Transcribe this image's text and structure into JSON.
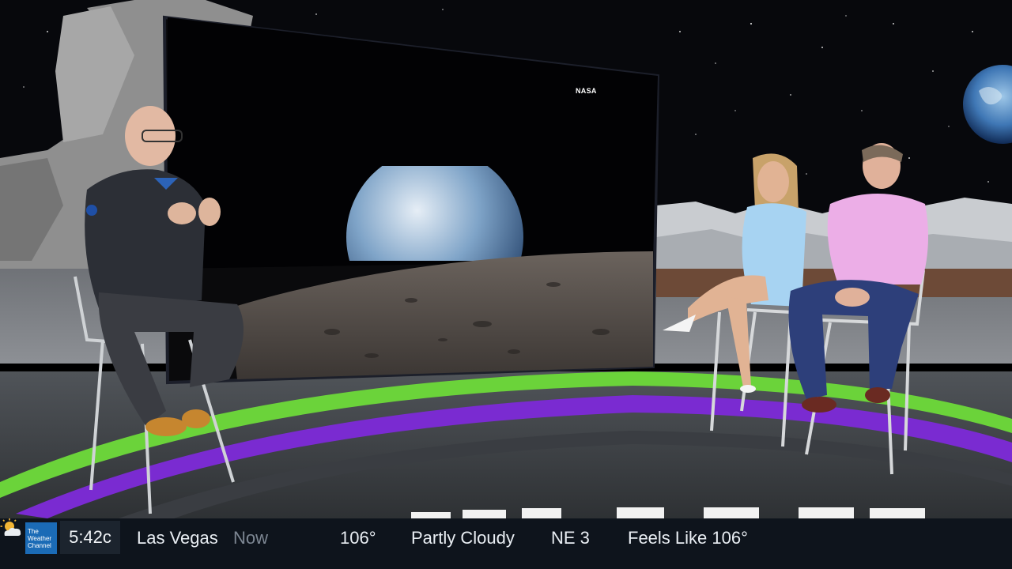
{
  "screen": {
    "watermark": "NASA"
  },
  "ticker": {
    "logo_line1": "The",
    "logo_line2": "Weather",
    "logo_line3": "Channel",
    "time": "5:42c",
    "location": "Las Vegas",
    "now_label": "Now",
    "weather_icon": "partly-cloudy-icon",
    "temperature": "106°",
    "condition": "Partly Cloudy",
    "wind": "NE 3",
    "feels_like": "Feels Like 106°"
  },
  "colors": {
    "ring_green": "#6bd33a",
    "ring_purple": "#7a2bd1",
    "ticker_bg": "#0e141c",
    "logo_blue": "#1b6bb6"
  }
}
